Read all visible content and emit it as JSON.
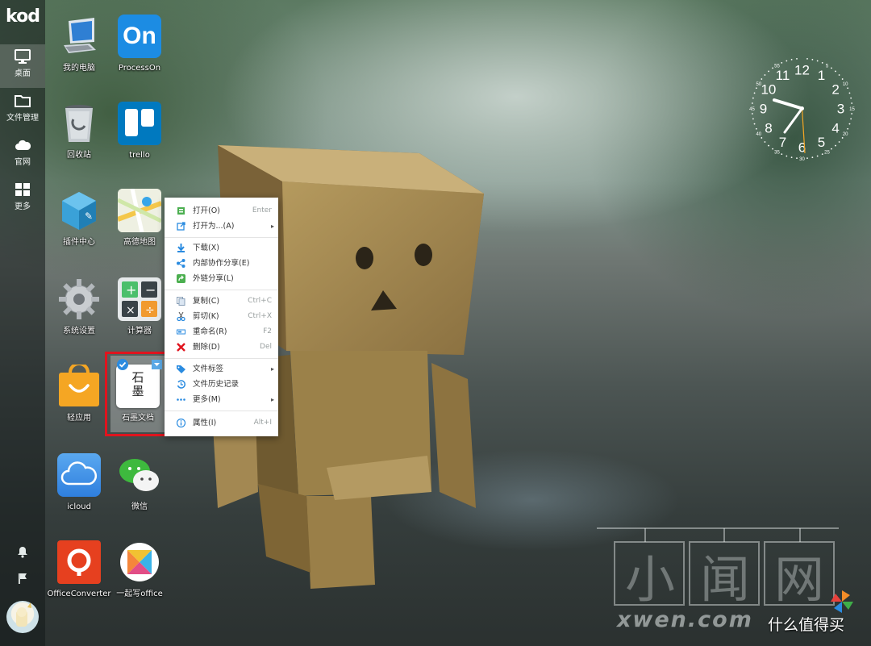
{
  "sidebar": {
    "logo": "kod",
    "items": [
      {
        "label": "桌面",
        "icon": "monitor-icon"
      },
      {
        "label": "文件管理",
        "icon": "folder-icon"
      },
      {
        "label": "官网",
        "icon": "cloud-icon"
      },
      {
        "label": "更多",
        "icon": "grid-icon"
      }
    ],
    "bottom_icons": [
      "bell-icon",
      "flag-icon"
    ]
  },
  "desktop": {
    "icons": [
      {
        "label": "我的电脑",
        "icon": "computer-icon"
      },
      {
        "label": "ProcessOn",
        "icon": "processon-icon"
      },
      {
        "label": "回收站",
        "icon": "recycle-bin-icon"
      },
      {
        "label": "trello",
        "icon": "trello-icon"
      },
      {
        "label": "插件中心",
        "icon": "plugin-center-icon"
      },
      {
        "label": "高德地图",
        "icon": "map-icon"
      },
      {
        "label": "系统设置",
        "icon": "settings-icon"
      },
      {
        "label": "计算器",
        "icon": "calculator-icon"
      },
      {
        "label": "轻应用",
        "icon": "light-app-icon"
      },
      {
        "label": "石墨文档",
        "icon": "shimo-doc-icon",
        "text": "石墨"
      },
      {
        "label": "icloud",
        "icon": "icloud-icon"
      },
      {
        "label": "微信",
        "icon": "wechat-icon"
      },
      {
        "label": "OfficeConverter",
        "icon": "office-converter-icon"
      },
      {
        "label": "一起写office",
        "icon": "yiqixie-icon"
      }
    ],
    "processon_text": "On"
  },
  "context_menu": {
    "items": [
      {
        "label": "打开(O)",
        "shortcut": "Enter",
        "icon": "open-icon"
      },
      {
        "label": "打开为...(A)",
        "shortcut": "",
        "icon": "open-with-icon",
        "submenu": true
      },
      {
        "label": "下载(X)",
        "shortcut": "",
        "icon": "download-icon"
      },
      {
        "label": "内部协作分享(E)",
        "shortcut": "",
        "icon": "share-icon"
      },
      {
        "label": "外链分享(L)",
        "shortcut": "",
        "icon": "external-share-icon"
      },
      {
        "label": "复制(C)",
        "shortcut": "Ctrl+C",
        "icon": "copy-icon"
      },
      {
        "label": "剪切(K)",
        "shortcut": "Ctrl+X",
        "icon": "cut-icon"
      },
      {
        "label": "重命名(R)",
        "shortcut": "F2",
        "icon": "rename-icon"
      },
      {
        "label": "删除(D)",
        "shortcut": "Del",
        "icon": "delete-icon"
      },
      {
        "label": "文件标签",
        "shortcut": "",
        "icon": "tag-icon",
        "submenu": true
      },
      {
        "label": "文件历史记录",
        "shortcut": "",
        "icon": "history-icon"
      },
      {
        "label": "更多(M)",
        "shortcut": "",
        "icon": "more-icon",
        "submenu": true
      },
      {
        "label": "属性(I)",
        "shortcut": "Alt+I",
        "icon": "info-icon"
      }
    ],
    "submenu_arrow": "▸"
  },
  "clock": {
    "hour_numbers": [
      "12",
      "1",
      "2",
      "3",
      "4",
      "5",
      "6",
      "7",
      "8",
      "9",
      "10",
      "11"
    ],
    "minute_numbers": [
      "55",
      "5",
      "10",
      "15",
      "20",
      "25",
      "30",
      "35",
      "40",
      "45",
      "50"
    ]
  },
  "watermark": {
    "chars": [
      "小",
      "闻",
      "网"
    ],
    "url": "xwen.com",
    "brand": "什么值得买"
  }
}
